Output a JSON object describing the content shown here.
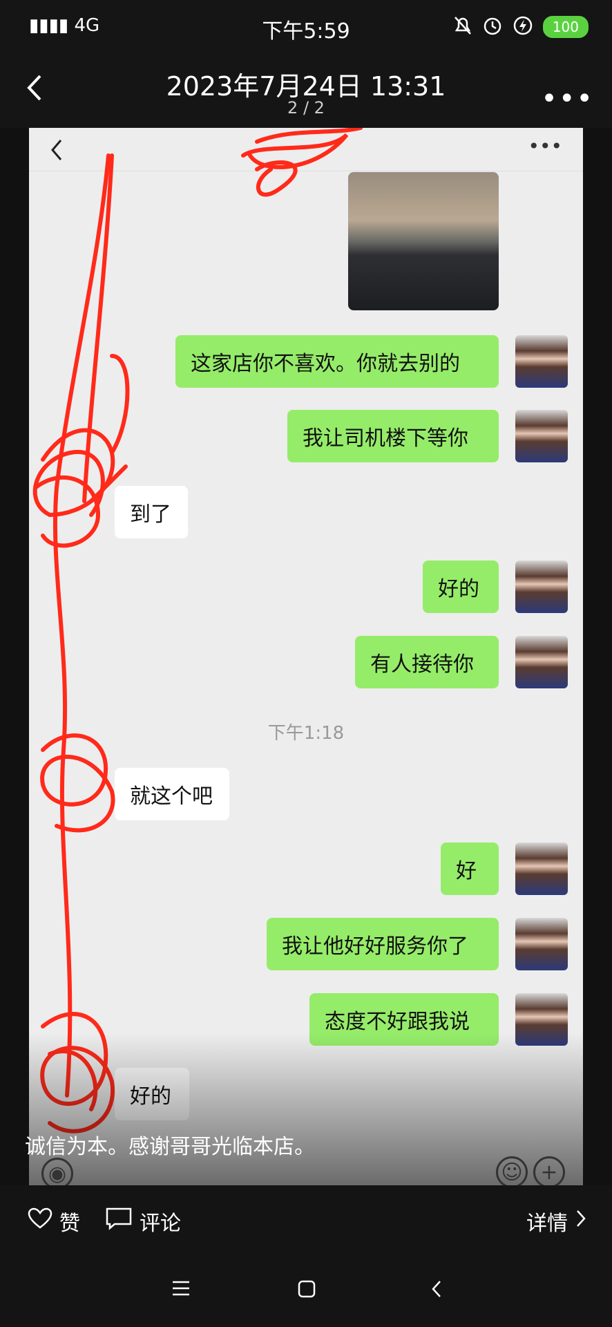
{
  "status_bar": {
    "network": "4G",
    "time": "下午5:59",
    "battery": "100"
  },
  "top_bar": {
    "title": "2023年7月24日 13:31",
    "page_indicator": "2 / 2"
  },
  "chat": {
    "messages": [
      {
        "side": "sent",
        "text": "这家店你不喜欢。你就去别的"
      },
      {
        "side": "sent",
        "text": "我让司机楼下等你"
      },
      {
        "side": "recv",
        "text": "到了"
      },
      {
        "side": "sent",
        "text": "好的"
      },
      {
        "side": "sent",
        "text": "有人接待你"
      },
      {
        "side": "recv",
        "text": "就这个吧"
      },
      {
        "side": "sent",
        "text": "好"
      },
      {
        "side": "sent",
        "text": "我让他好好服务你了"
      },
      {
        "side": "sent",
        "text": "态度不好跟我说"
      },
      {
        "side": "recv",
        "text": "好的"
      }
    ],
    "timestamp": "下午1:18"
  },
  "caption": "诚信为本。感谢哥哥光临本店。",
  "bottom_bar": {
    "like_label": "赞",
    "comment_label": "评论",
    "details_label": "详情"
  },
  "colors": {
    "sent_bubble": "#95ec69",
    "recv_bubble": "#ffffff",
    "scribble": "#ff2a1a"
  }
}
